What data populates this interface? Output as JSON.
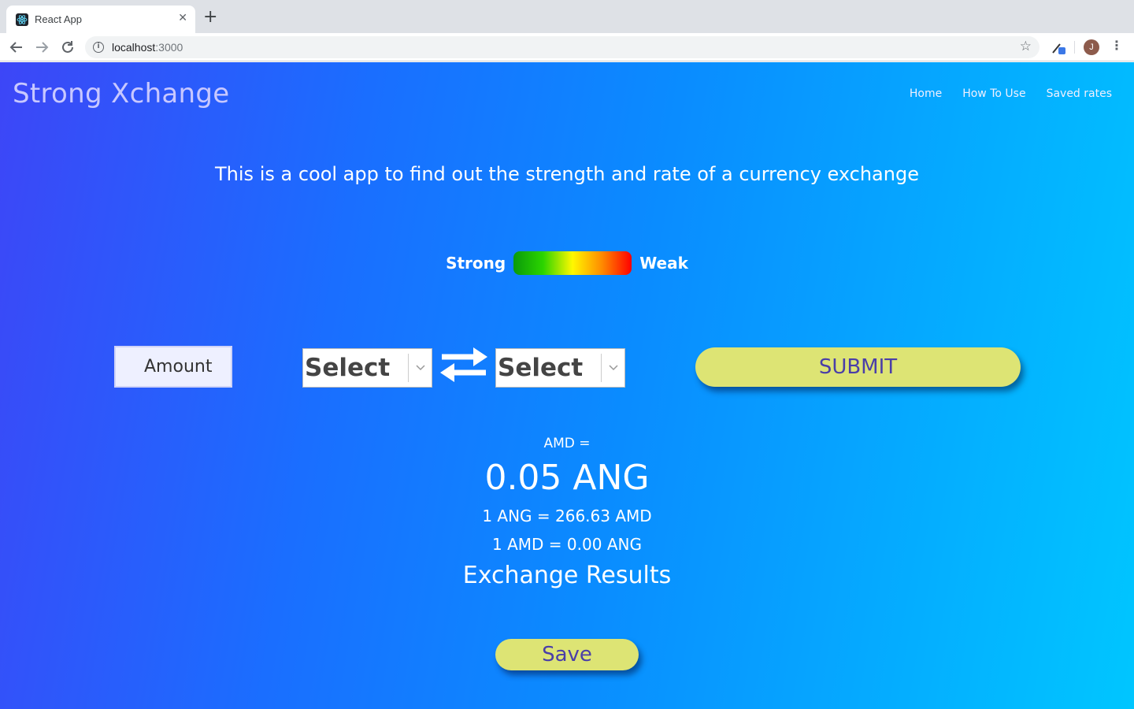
{
  "browser": {
    "tab_title": "React App",
    "tab_close_glyph": "✕",
    "new_tab_glyph": "+",
    "url_host": "localhost",
    "url_port": ":3000",
    "profile_initial": "J",
    "icons": [
      "react-favicon-icon",
      "back-arrow-icon",
      "forward-arrow-icon",
      "reload-icon",
      "info-icon",
      "star-icon",
      "extension-icon",
      "menu-icon"
    ]
  },
  "app": {
    "brand": "Strong Xchange",
    "nav": [
      "Home",
      "How To Use",
      "Saved rates"
    ],
    "tagline": "This is a cool app to find out the strength and rate of a currency exchange",
    "legend": {
      "strong": "Strong",
      "weak": "Weak"
    },
    "form": {
      "amount_placeholder": "Amount",
      "from_select": "Select",
      "to_select": "Select",
      "submit": "SUBMIT"
    },
    "results": {
      "from_line": "AMD =",
      "main": "0.05 ANG",
      "rate_1": "1 ANG = 266.63 AMD",
      "rate_2": "1 AMD = 0.00 ANG",
      "title": "Exchange Results"
    },
    "save": "Save"
  },
  "colors": {
    "gradient_start": "#3d46f7",
    "gradient_end": "#00c6ff",
    "button_bg": "#dde474",
    "button_text": "#4a3ea8"
  }
}
